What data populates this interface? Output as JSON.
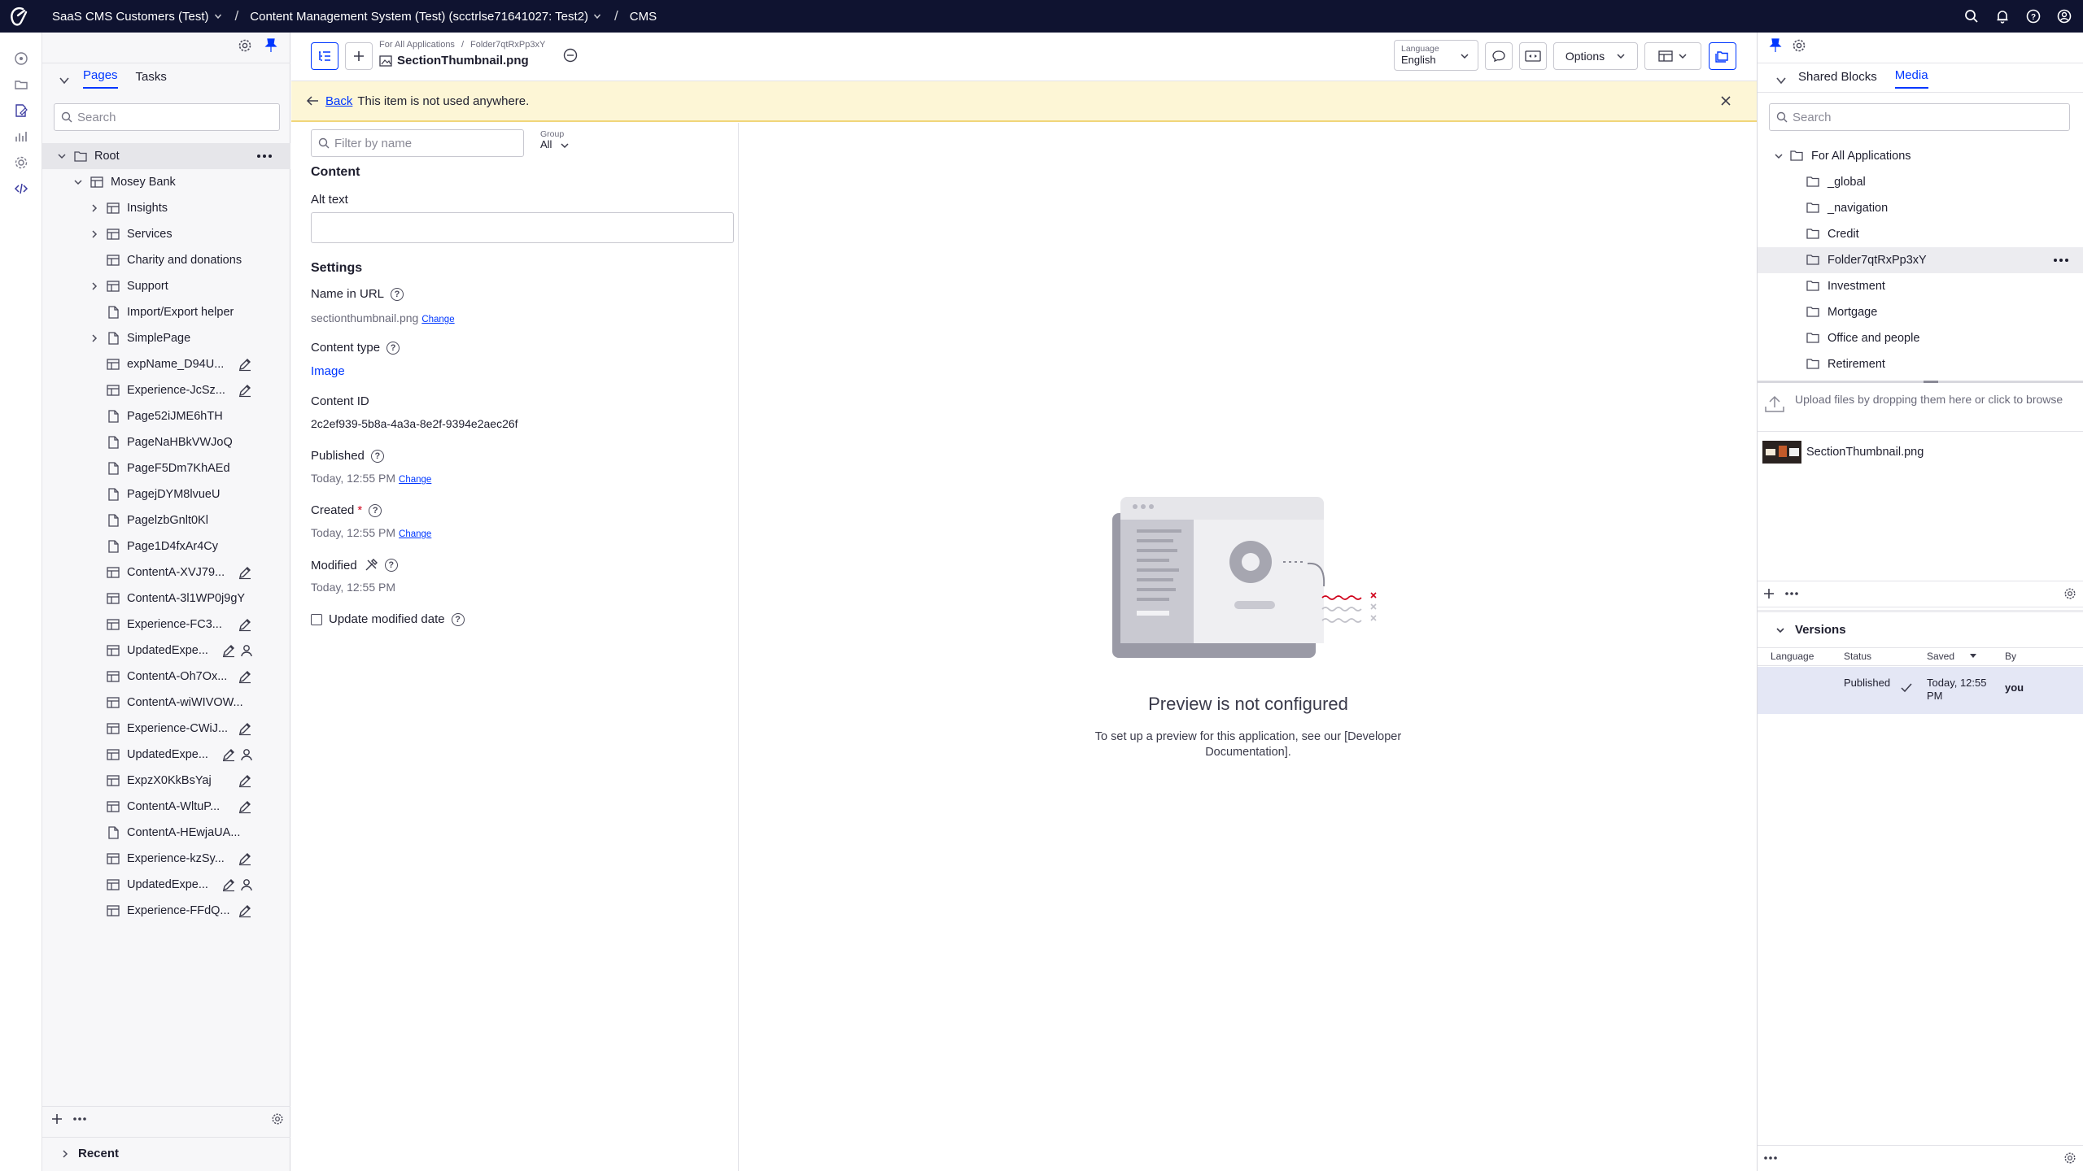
{
  "topbar": {
    "breadcrumbs": [
      {
        "label": "SaaS CMS Customers (Test)",
        "dropdown": true
      },
      {
        "label": "Content Management System (Test) (scctrlse71641027: Test2)",
        "dropdown": true
      },
      {
        "label": "CMS",
        "dropdown": false
      }
    ]
  },
  "left_panel": {
    "tabs": [
      "Pages",
      "Tasks"
    ],
    "active_tab": "Pages",
    "search_placeholder": "Search",
    "tree": [
      {
        "label": "Root",
        "level": 0,
        "expanded": true,
        "icon": "folder-icon",
        "selected": true
      },
      {
        "label": "Mosey Bank",
        "level": 1,
        "expanded": true,
        "icon": "block-page-icon"
      },
      {
        "label": "Insights",
        "level": 2,
        "collapsed": true,
        "icon": "block-page-icon"
      },
      {
        "label": "Services",
        "level": 2,
        "collapsed": true,
        "icon": "block-page-icon"
      },
      {
        "label": "Charity and donations",
        "level": 2,
        "icon": "block-page-icon"
      },
      {
        "label": "Support",
        "level": 2,
        "collapsed": true,
        "icon": "block-page-icon"
      },
      {
        "label": "Import/Export helper",
        "level": 2,
        "icon": "page-icon"
      },
      {
        "label": "SimplePage",
        "level": 2,
        "collapsed": true,
        "icon": "page-icon"
      },
      {
        "label": "expName_D94U...",
        "level": 2,
        "icon": "block-page-icon",
        "badges": [
          "edit"
        ]
      },
      {
        "label": "Experience-JcSz...",
        "level": 2,
        "icon": "block-page-icon",
        "badges": [
          "edit"
        ]
      },
      {
        "label": "Page52iJME6hTH",
        "level": 2,
        "icon": "page-icon"
      },
      {
        "label": "PageNaHBkVWJoQ",
        "level": 2,
        "icon": "page-icon"
      },
      {
        "label": "PageF5Dm7KhAEd",
        "level": 2,
        "icon": "page-icon"
      },
      {
        "label": "PagejDYM8lvueU",
        "level": 2,
        "icon": "page-icon"
      },
      {
        "label": "PagelzbGnlt0Kl",
        "level": 2,
        "icon": "page-icon"
      },
      {
        "label": "Page1D4fxAr4Cy",
        "level": 2,
        "icon": "page-icon"
      },
      {
        "label": "ContentA-XVJ79...",
        "level": 2,
        "icon": "block-page-icon",
        "badges": [
          "edit"
        ]
      },
      {
        "label": "ContentA-3l1WP0j9gY",
        "level": 2,
        "icon": "block-page-icon"
      },
      {
        "label": "Experience-FC3...",
        "level": 2,
        "icon": "block-page-icon",
        "badges": [
          "edit"
        ]
      },
      {
        "label": "UpdatedExpe...",
        "level": 2,
        "icon": "block-page-icon",
        "badges": [
          "edit",
          "user"
        ]
      },
      {
        "label": "ContentA-Oh7Ox...",
        "level": 2,
        "icon": "block-page-icon",
        "badges": [
          "edit"
        ]
      },
      {
        "label": "ContentA-wiWIVOW...",
        "level": 2,
        "icon": "block-page-icon"
      },
      {
        "label": "Experience-CWiJ...",
        "level": 2,
        "icon": "block-page-icon",
        "badges": [
          "edit"
        ]
      },
      {
        "label": "UpdatedExpe...",
        "level": 2,
        "icon": "block-page-icon",
        "badges": [
          "edit",
          "user"
        ]
      },
      {
        "label": "ExpzX0KkBsYaj",
        "level": 2,
        "icon": "block-page-icon",
        "badges": [
          "edit"
        ]
      },
      {
        "label": "ContentA-WltuP...",
        "level": 2,
        "icon": "block-page-icon",
        "badges": [
          "edit"
        ]
      },
      {
        "label": "ContentA-HEwjaUA...",
        "level": 2,
        "icon": "page-icon"
      },
      {
        "label": "Experience-kzSy...",
        "level": 2,
        "icon": "block-page-icon",
        "badges": [
          "edit"
        ]
      },
      {
        "label": "UpdatedExpe...",
        "level": 2,
        "icon": "block-page-icon",
        "badges": [
          "edit",
          "user"
        ]
      },
      {
        "label": "Experience-FFdQ...",
        "level": 2,
        "icon": "block-page-icon",
        "badges": [
          "edit"
        ]
      }
    ],
    "recent_label": "Recent"
  },
  "toolbar": {
    "breadcrumb_parent": "For All Applications",
    "breadcrumb_folder": "Folder7qtRxPp3xY",
    "item_title": "SectionThumbnail.png",
    "language_label": "Language",
    "language_value": "English",
    "options_label": "Options"
  },
  "banner": {
    "back_label": "Back",
    "message": "This item is not used anywhere."
  },
  "form": {
    "filter_placeholder": "Filter by name",
    "group_label": "Group",
    "group_value": "All",
    "content_title": "Content",
    "alt_text_label": "Alt text",
    "alt_text_value": "",
    "settings_title": "Settings",
    "name_in_url_label": "Name in URL",
    "name_in_url_value": "sectionthumbnail.png",
    "change_label": "Change",
    "content_type_label": "Content type",
    "content_type_value": "Image",
    "content_id_label": "Content ID",
    "content_id_value": "2c2ef939-5b8a-4a3a-8e2f-9394e2aec26f",
    "published_label": "Published",
    "published_value": "Today, 12:55 PM",
    "created_label": "Created",
    "created_required_mark": "*",
    "created_value": "Today, 12:55 PM",
    "modified_label": "Modified",
    "modified_value": "Today, 12:55 PM",
    "update_modified_label": "Update modified date",
    "update_modified_checked": false
  },
  "preview": {
    "title": "Preview is not configured",
    "text_before_link": "To set up a preview for this application, see our ",
    "link_text": "[Developer Documentation]",
    "text_after_link": "."
  },
  "right_panel": {
    "tabs": [
      "Shared Blocks",
      "Media"
    ],
    "active_tab": "Media",
    "search_placeholder": "Search",
    "folders": [
      {
        "label": "For All Applications",
        "level": 0,
        "expanded": true
      },
      {
        "label": "_global",
        "level": 1
      },
      {
        "label": "_navigation",
        "level": 1
      },
      {
        "label": "Credit",
        "level": 1
      },
      {
        "label": "Folder7qtRxPp3xY",
        "level": 1,
        "selected": true
      },
      {
        "label": "Investment",
        "level": 1
      },
      {
        "label": "Mortgage",
        "level": 1
      },
      {
        "label": "Office and people",
        "level": 1
      },
      {
        "label": "Retirement",
        "level": 1
      }
    ],
    "upload_text": "Upload files by dropping them here or click to browse",
    "media_items": [
      {
        "name": "SectionThumbnail.png"
      }
    ],
    "versions_title": "Versions",
    "versions_columns": [
      "Language",
      "Status",
      "Saved",
      "By"
    ],
    "versions_rows": [
      {
        "language": "",
        "status": "Published",
        "saved": "Today, 12:55 PM",
        "by": "you"
      }
    ]
  },
  "colors": {
    "topbar_bg": "#0f1330",
    "accent": "#0037ff",
    "banner_bg": "#fdf6d6"
  }
}
